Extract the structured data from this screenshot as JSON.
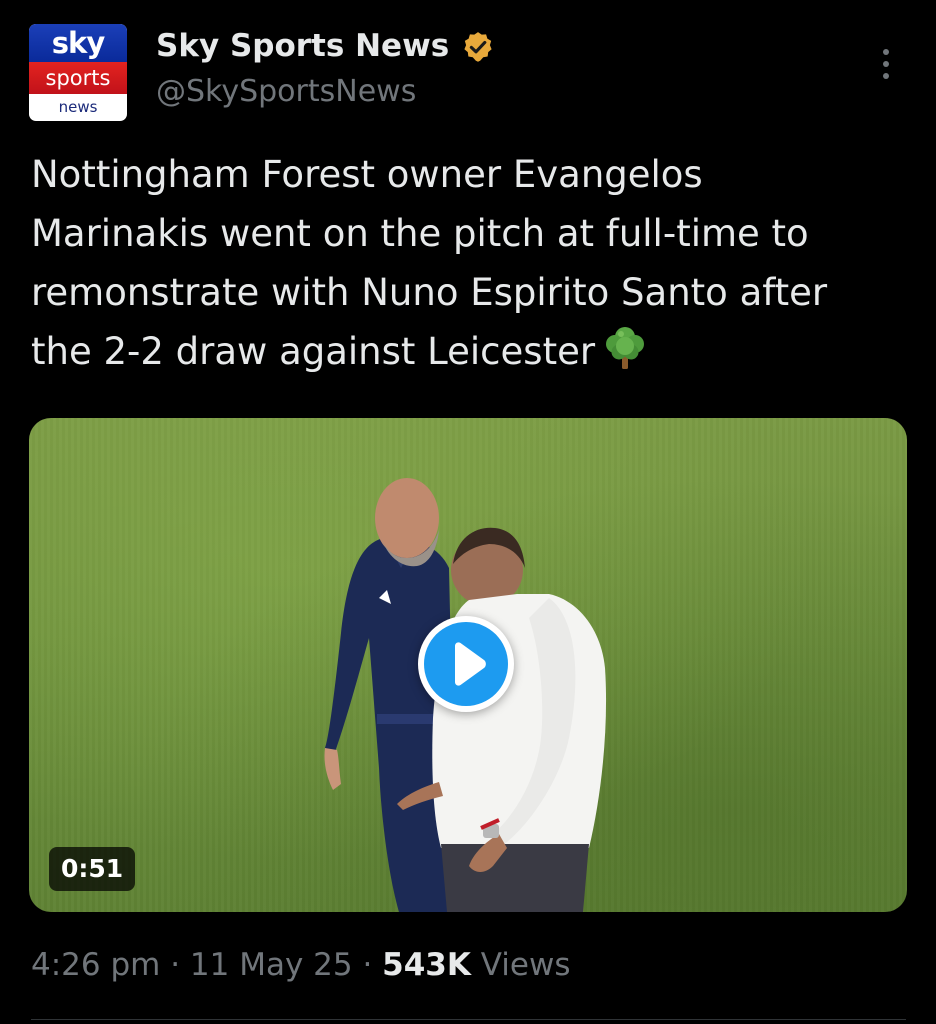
{
  "author": {
    "display_name": "Sky Sports News",
    "handle": "@SkySportsNews",
    "verified": true,
    "verified_badge_color": "#e8a93b",
    "avatar": {
      "line1": "sky",
      "line2": "sports",
      "line3": "news"
    }
  },
  "menu": {
    "icon": "more-vertical-icon"
  },
  "tweet": {
    "text_lines": [
      "Nottingham Forest owner Evangelos",
      "Marinakis went on the pitch at full-time to",
      "remonstrate with Nuno Espirito Santo after",
      "the 2-2 draw against Leicester"
    ],
    "emoji": "tree-icon"
  },
  "media": {
    "type": "video",
    "duration": "0:51",
    "play_icon": "play-icon",
    "accent_color": "#1d9bf0"
  },
  "meta": {
    "time": "4:26 pm",
    "separator1": " · ",
    "date": "11 May 25",
    "separator2": " · ",
    "views_count": "543K",
    "views_label": " Views"
  },
  "colors": {
    "background": "#000000",
    "primary_text": "#e7e9ea",
    "secondary_text": "#71767b"
  }
}
